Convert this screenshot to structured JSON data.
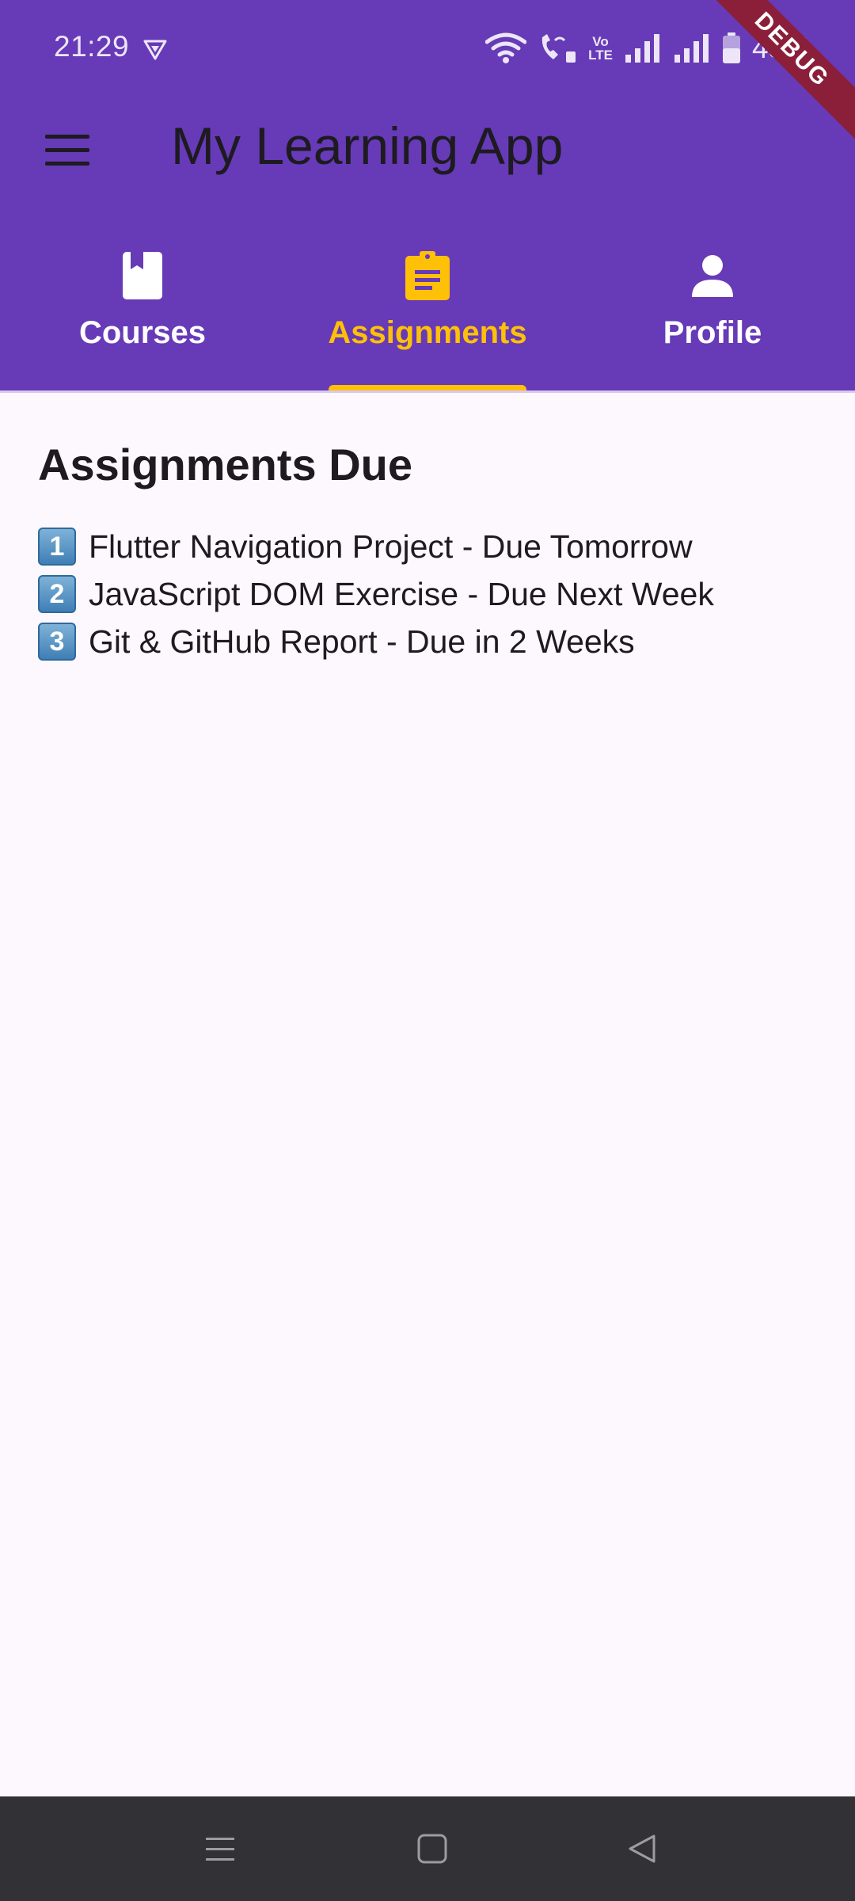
{
  "status_bar": {
    "time": "21:29",
    "volte_top": "Vo",
    "volte_bottom": "LTE",
    "battery": "43%"
  },
  "app_bar": {
    "title": "My Learning App",
    "menu_icon": "hamburger-menu-icon"
  },
  "debug_banner": "DEBUG",
  "tabs": [
    {
      "label": "Courses",
      "icon": "book-icon",
      "active": false
    },
    {
      "label": "Assignments",
      "icon": "clipboard-icon",
      "active": true
    },
    {
      "label": "Profile",
      "icon": "person-icon",
      "active": false
    }
  ],
  "content": {
    "heading": "Assignments Due",
    "items": [
      {
        "number": "1",
        "text": "Flutter Navigation Project - Due Tomorrow"
      },
      {
        "number": "2",
        "text": "JavaScript DOM Exercise - Due Next Week"
      },
      {
        "number": "3",
        "text": "Git & GitHub Report - Due in 2 Weeks"
      }
    ]
  },
  "navbar": {
    "recents_icon": "recents-icon",
    "home_icon": "home-icon",
    "back_icon": "back-icon"
  },
  "colors": {
    "app_bar": "#673ab7",
    "accent": "#ffc107",
    "background": "#fdf7fe",
    "navbar": "#323135"
  }
}
